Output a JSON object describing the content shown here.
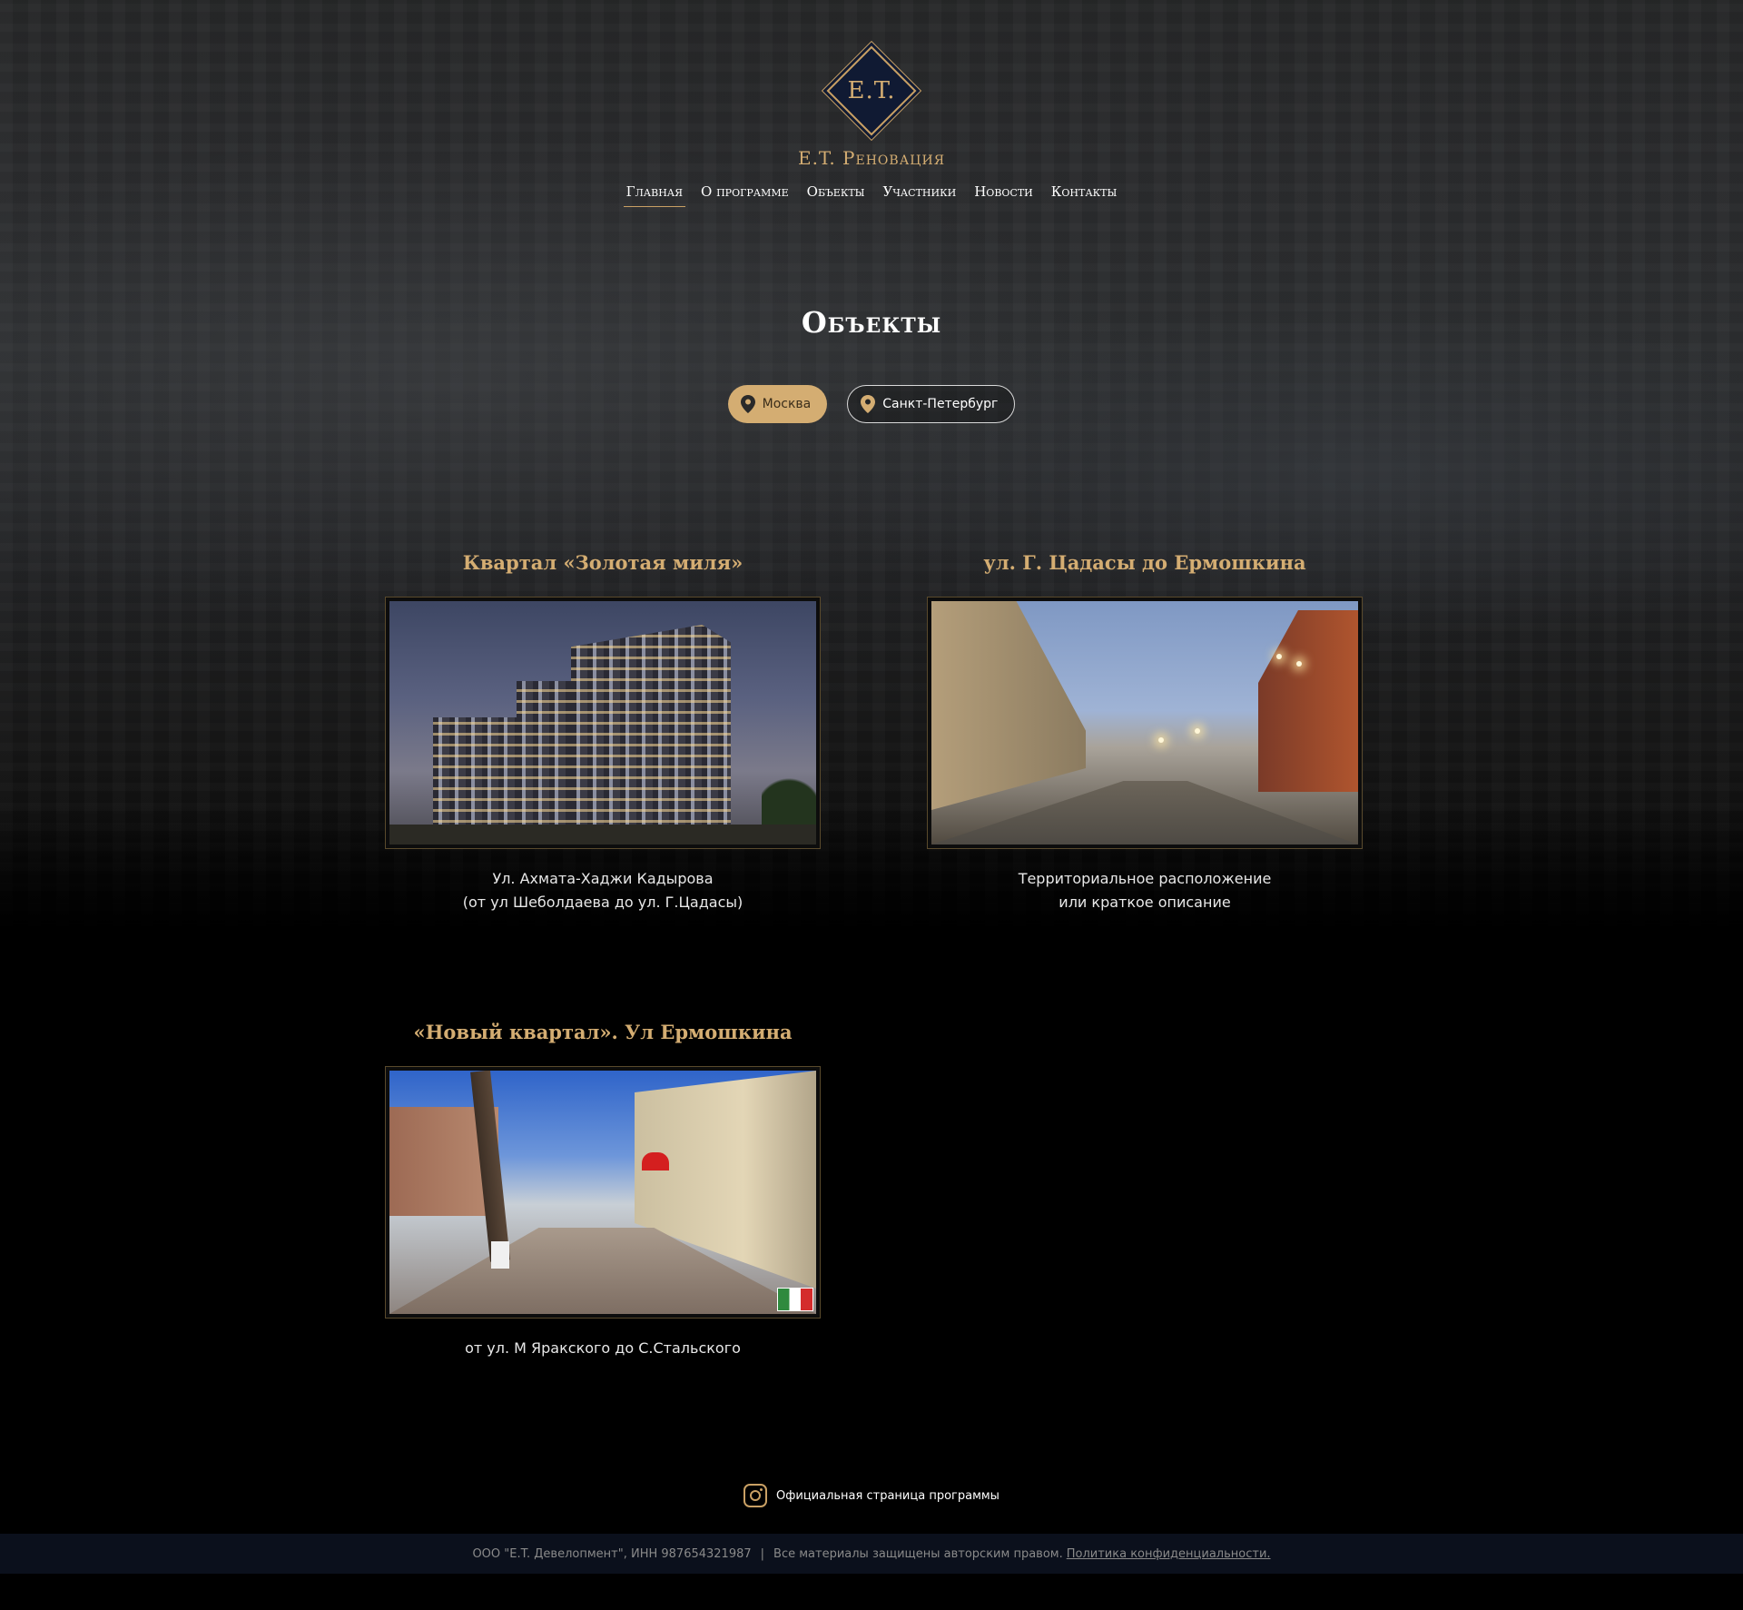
{
  "header": {
    "logo_text": "E.T.",
    "brand_name": "E.T. Реновация"
  },
  "nav": {
    "items": [
      {
        "label": "Главная",
        "active": true
      },
      {
        "label": "О программе"
      },
      {
        "label": "Объекты"
      },
      {
        "label": "Участники"
      },
      {
        "label": "Новости"
      },
      {
        "label": "Контакты"
      }
    ]
  },
  "page_title": "Объекты",
  "filters": [
    {
      "label": "Москва",
      "icon": "map-pin-icon",
      "active": true
    },
    {
      "label": "Санкт-Петербург",
      "icon": "map-pin-icon",
      "active": false
    }
  ],
  "objects": [
    {
      "title": "Квартал «Золотая миля»",
      "desc_line1": "Ул. Ахмата-Хаджи Кадырова",
      "desc_line2": "(от ул Шеболдаева до ул. Г.Цадасы)"
    },
    {
      "title": "ул. Г. Цадасы до Ермошкина",
      "desc_line1": "Территориальное расположение",
      "desc_line2": "или краткое описание"
    },
    {
      "title": "«Новый квартал». Ул Ермошкина",
      "desc_line1": "от ул. М Яракского до С.Стальского",
      "desc_line2": ""
    }
  ],
  "footer": {
    "social_text": "Официальная страница программы",
    "social_icon": "instagram-icon",
    "company": "ООО \"E.T. Девелопмент\", ИНН 987654321987",
    "separator": "|",
    "rights": "Все материалы защищены авторским правом.",
    "policy": "Политика конфиденциальности."
  },
  "colors": {
    "accent": "#d4ad72",
    "footer_bg": "#0b101c",
    "logo_bg": "#101a33"
  }
}
